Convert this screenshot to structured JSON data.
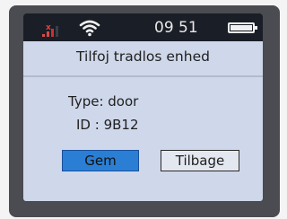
{
  "status": {
    "time": "09 51",
    "signal_icon": "signal-weak-icon",
    "wifi_icon": "wifi-icon",
    "battery_icon": "battery-full-icon",
    "battery_level": 1.0
  },
  "title": "Tilfoj tradlos enhed",
  "device": {
    "type_line": "Type: door",
    "id_line": "ID : 9B12"
  },
  "buttons": {
    "save_label": "Gem",
    "back_label": "Tilbage"
  },
  "colors": {
    "screen_bg": "#cfd8ea",
    "statusbar_bg": "#1a1e26",
    "save_button_bg": "#2a7fd4",
    "bezel": "#4a4c52"
  }
}
